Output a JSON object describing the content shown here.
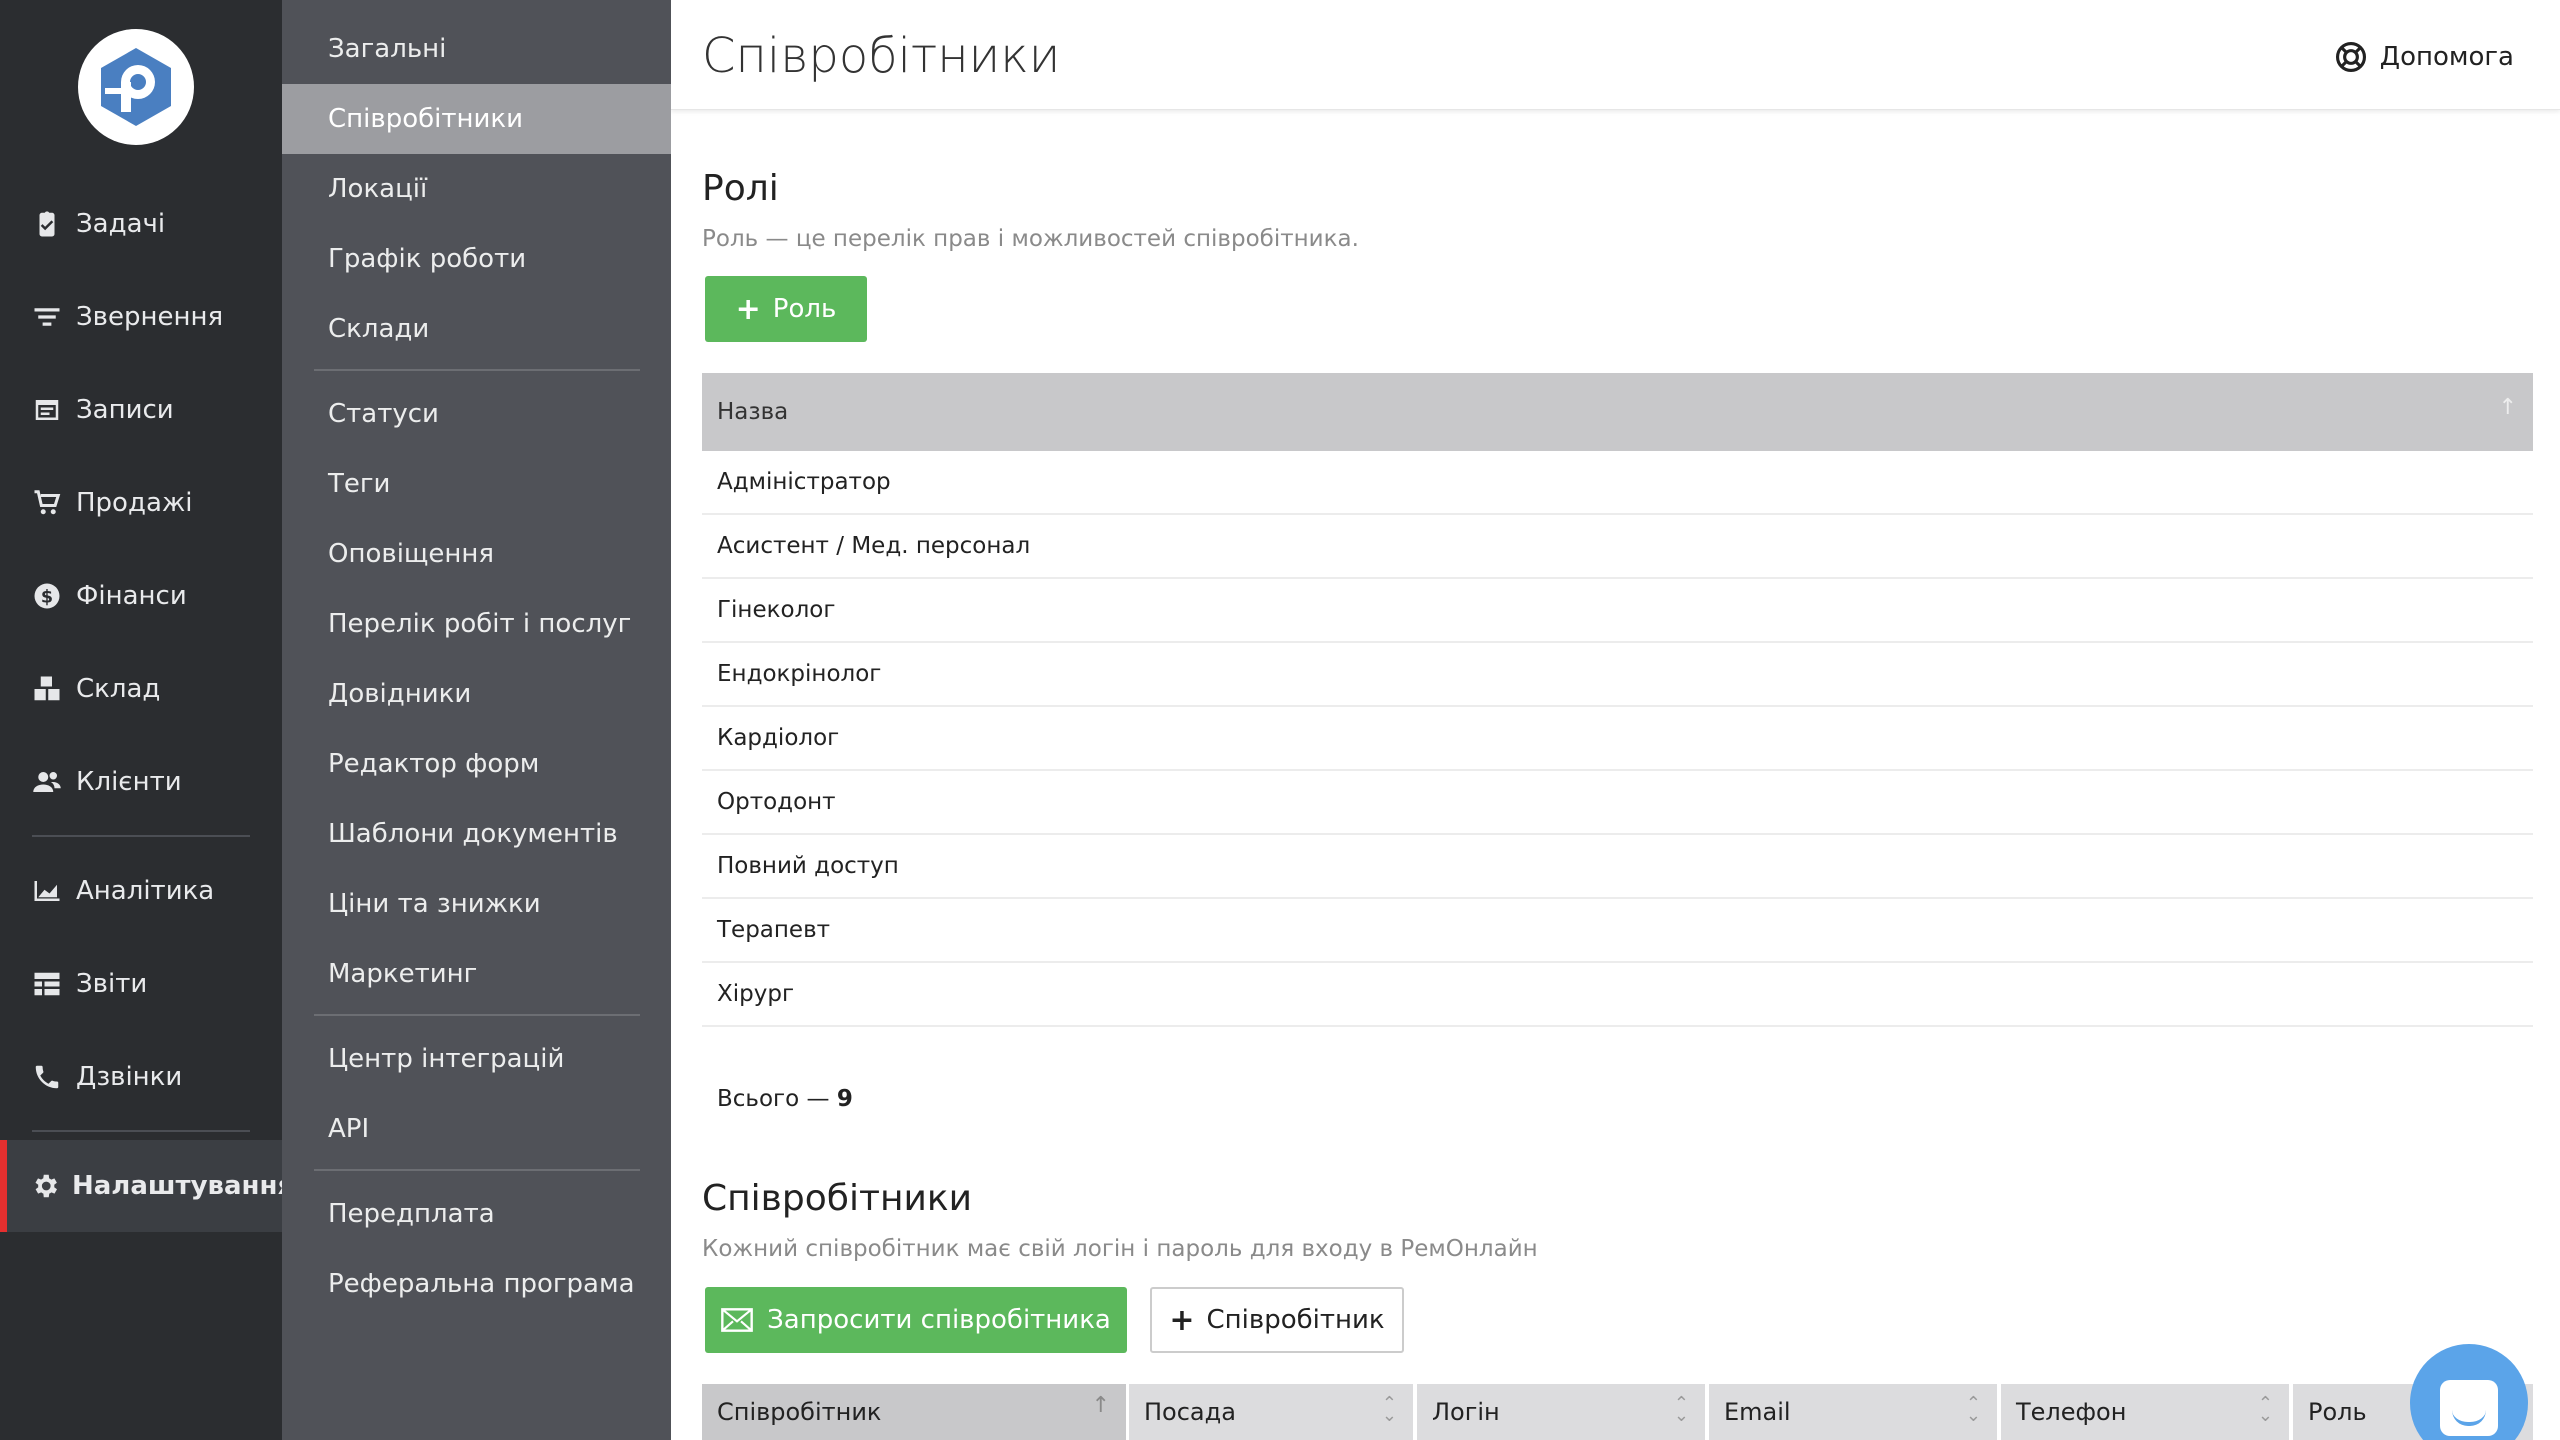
{
  "nav": {
    "items": [
      {
        "label": "Задачі",
        "icon": "clipboard-check-icon"
      },
      {
        "label": "Звернення",
        "icon": "funnel-icon"
      },
      {
        "label": "Записи",
        "icon": "calendar-list-icon"
      },
      {
        "label": "Продажі",
        "icon": "cart-icon"
      },
      {
        "label": "Фінанси",
        "icon": "dollar-circle-icon"
      },
      {
        "label": "Склад",
        "icon": "boxes-icon"
      },
      {
        "label": "Клієнти",
        "icon": "users-icon"
      },
      {
        "label": "Аналітика",
        "icon": "chart-area-icon"
      },
      {
        "label": "Звіти",
        "icon": "table-icon"
      },
      {
        "label": "Дзвінки",
        "icon": "phone-icon"
      },
      {
        "label": "Налаштування",
        "icon": "gear-icon"
      }
    ],
    "active_index": 10
  },
  "settings_menu": {
    "items": [
      "Загальні",
      "Співробітники",
      "Локації",
      "Графік роботи",
      "Склади",
      "Статуси",
      "Теги",
      "Оповіщення",
      "Перелік робіт і послуг",
      "Довідники",
      "Редактор форм",
      "Шаблони документів",
      "Ціни та знижки",
      "Маркетинг",
      "Центр інтеграцій",
      "API",
      "Передплата",
      "Реферальна програма"
    ],
    "active_index": 1
  },
  "header": {
    "title": "Співробітники",
    "help_label": "Допомога"
  },
  "roles": {
    "title": "Ролі",
    "description": "Роль — це перелік прав і можливостей співробітника.",
    "add_button": "Роль",
    "column_name": "Назва",
    "rows": [
      "Адміністратор",
      "Асистент / Мед. персонал",
      "Гінеколог",
      "Ендокрінолог",
      "Кардіолог",
      "Ортодонт",
      "Повний доступ",
      "Терапевт",
      "Хірург"
    ],
    "total_label": "Всього —",
    "total_value": "9"
  },
  "employees": {
    "title": "Співробітники",
    "description": "Кожний співробітник має свій логін і пароль для входу в РемОнлайн",
    "invite_button": "Запросити співробітника",
    "add_button": "Співробітник",
    "columns": [
      "Співробітник",
      "Посада",
      "Логін",
      "Email",
      "Телефон",
      "Роль"
    ]
  },
  "colors": {
    "accent_green": "#5cb85c",
    "active_marker": "#e52f2f",
    "logo_blue": "#4a7fc1",
    "chat_blue": "#5ba4e9"
  }
}
